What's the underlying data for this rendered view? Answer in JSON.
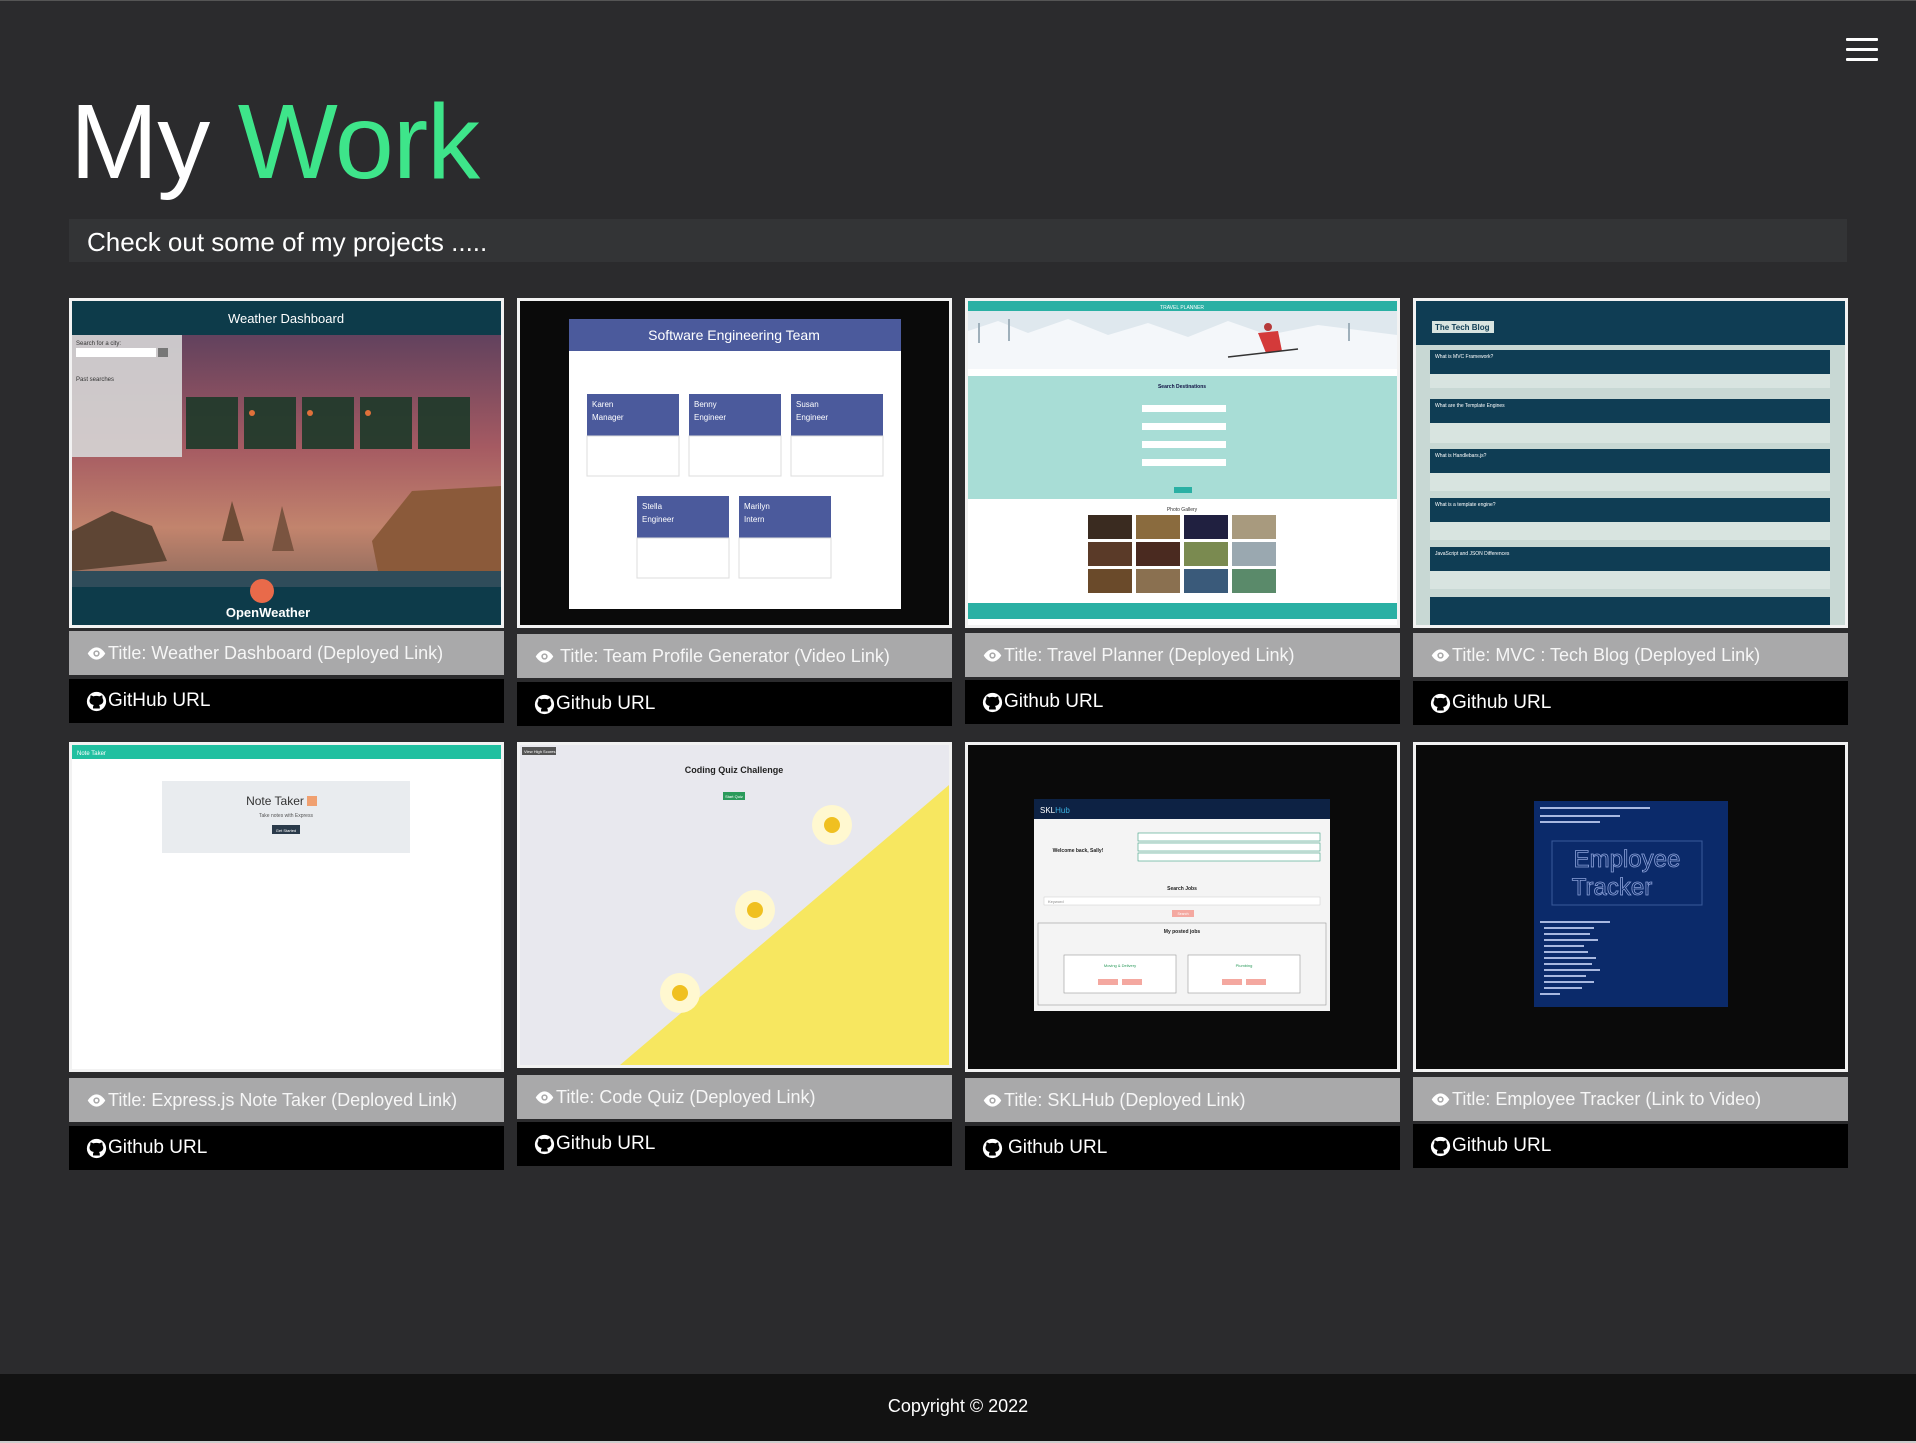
{
  "header": {
    "title_part1": "My",
    "title_part2": "Work",
    "subtitle": "Check out some of my projects .....",
    "menu_icon": "hamburger-menu-icon"
  },
  "colors": {
    "background": "#2b2b2d",
    "accent": "#3ee58a",
    "title_bar": "#a9a9aa",
    "github_bar": "#000000",
    "footer": "#121212"
  },
  "projects": [
    {
      "title": "Title: Weather Dashboard (Deployed Link)",
      "github": "GitHub URL",
      "preview": {
        "header": "Weather Dashboard",
        "search_label": "Search for a city:",
        "past_searches": "Past searches",
        "brand": "OpenWeather"
      }
    },
    {
      "title": "Title: Team Profile Generator (Video Link)",
      "github": "Github URL",
      "preview": {
        "header": "Software Engineering Team",
        "members": [
          {
            "name": "Karen",
            "role": "Manager"
          },
          {
            "name": "Benny",
            "role": "Engineer"
          },
          {
            "name": "Susan",
            "role": "Engineer"
          },
          {
            "name": "Stella",
            "role": "Engineer"
          },
          {
            "name": "Marilyn",
            "role": "Intern"
          }
        ]
      }
    },
    {
      "title": "Title: Travel Planner (Deployed Link)",
      "github": "Github URL",
      "preview": {
        "header": "TRAVEL PLANNER",
        "search_heading": "Search Destinations",
        "gallery_heading": "Photo Gallery"
      }
    },
    {
      "title": "Title: MVC : Tech Blog (Deployed Link)",
      "github": "Github URL",
      "preview": {
        "header": "The Tech Blog",
        "posts": [
          "What is MVC Framework?",
          "What are the Template Engines",
          "What is Handlebars.js?",
          "What is a template engine?",
          "JavaScript and JSON Differences"
        ]
      }
    },
    {
      "title": "Title: Express.js Note Taker (Deployed Link)",
      "github": "Github URL",
      "preview": {
        "header": "Note Taker",
        "heading": "Note Taker",
        "caption": "Take notes with Express",
        "button": "Get Started"
      }
    },
    {
      "title": "Title: Code Quiz (Deployed Link)",
      "github": "Github URL",
      "preview": {
        "heading": "Coding Quiz Challenge",
        "button": "Start Quiz",
        "corner": "View High Scores"
      }
    },
    {
      "title": "Title: SKLHub (Deployed Link)",
      "github": "Github URL",
      "preview": {
        "brand_a": "SKL",
        "brand_b": "Hub",
        "welcome": "Welcome back, Sally!",
        "search_heading": "Search Jobs",
        "search_placeholder": "Keyword",
        "search_button": "Search",
        "posted_heading": "My posted jobs",
        "jobs": [
          "Moving & Delivery",
          "Plumbing"
        ]
      }
    },
    {
      "title": "Title: Employee Tracker (Link to Video)",
      "github": "Github URL",
      "preview": {
        "banner_1": "Employee",
        "banner_2": "Tracker"
      }
    }
  ],
  "footer": {
    "copyright": "Copyright © 2022"
  }
}
